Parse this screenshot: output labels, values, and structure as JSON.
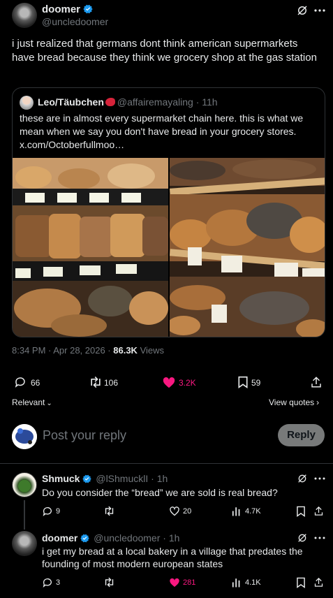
{
  "main_post": {
    "display_name": "doomer",
    "handle": "@uncledoomer",
    "text": "i just realized that germans dont think american supermarkets have bread because they think we grocery shop at the gas station",
    "time": "8:34 PM · Apr 28, 2026 · ",
    "views_count": "86.3K",
    "views_label": " Views",
    "stats": {
      "replies": "66",
      "reposts": "106",
      "likes": "3.2K",
      "bookmarks": "59"
    },
    "relevant_label": "Relevant",
    "view_quotes_label": "View quotes"
  },
  "quote": {
    "display_name": "Leo/Täubchen",
    "handle": "@affairemayaling",
    "time": "· 11h",
    "text": "these are in almost every supermarket chain here. this is what we mean when we say you don't have bread in your grocery stores. x.com/Octoberfullmoo…"
  },
  "compose": {
    "placeholder": "Post your reply",
    "button": "Reply"
  },
  "replies": [
    {
      "display_name": "Shmuck",
      "handle": "@lShmucklI · 1h",
      "text": "Do you consider the “bread” we are sold is real bread?",
      "replies": "9",
      "likes": "20",
      "views": "4.7K"
    },
    {
      "display_name": "doomer",
      "handle": "@uncledoomer · 1h",
      "text": "i get my bread at a local bakery in a village that predates the founding of most modern european states",
      "replies": "3",
      "likes": "281",
      "views": "4.1K"
    }
  ],
  "colors": {
    "accent": "#1d9bf0",
    "like": "#f91880",
    "muted": "#71767b"
  }
}
